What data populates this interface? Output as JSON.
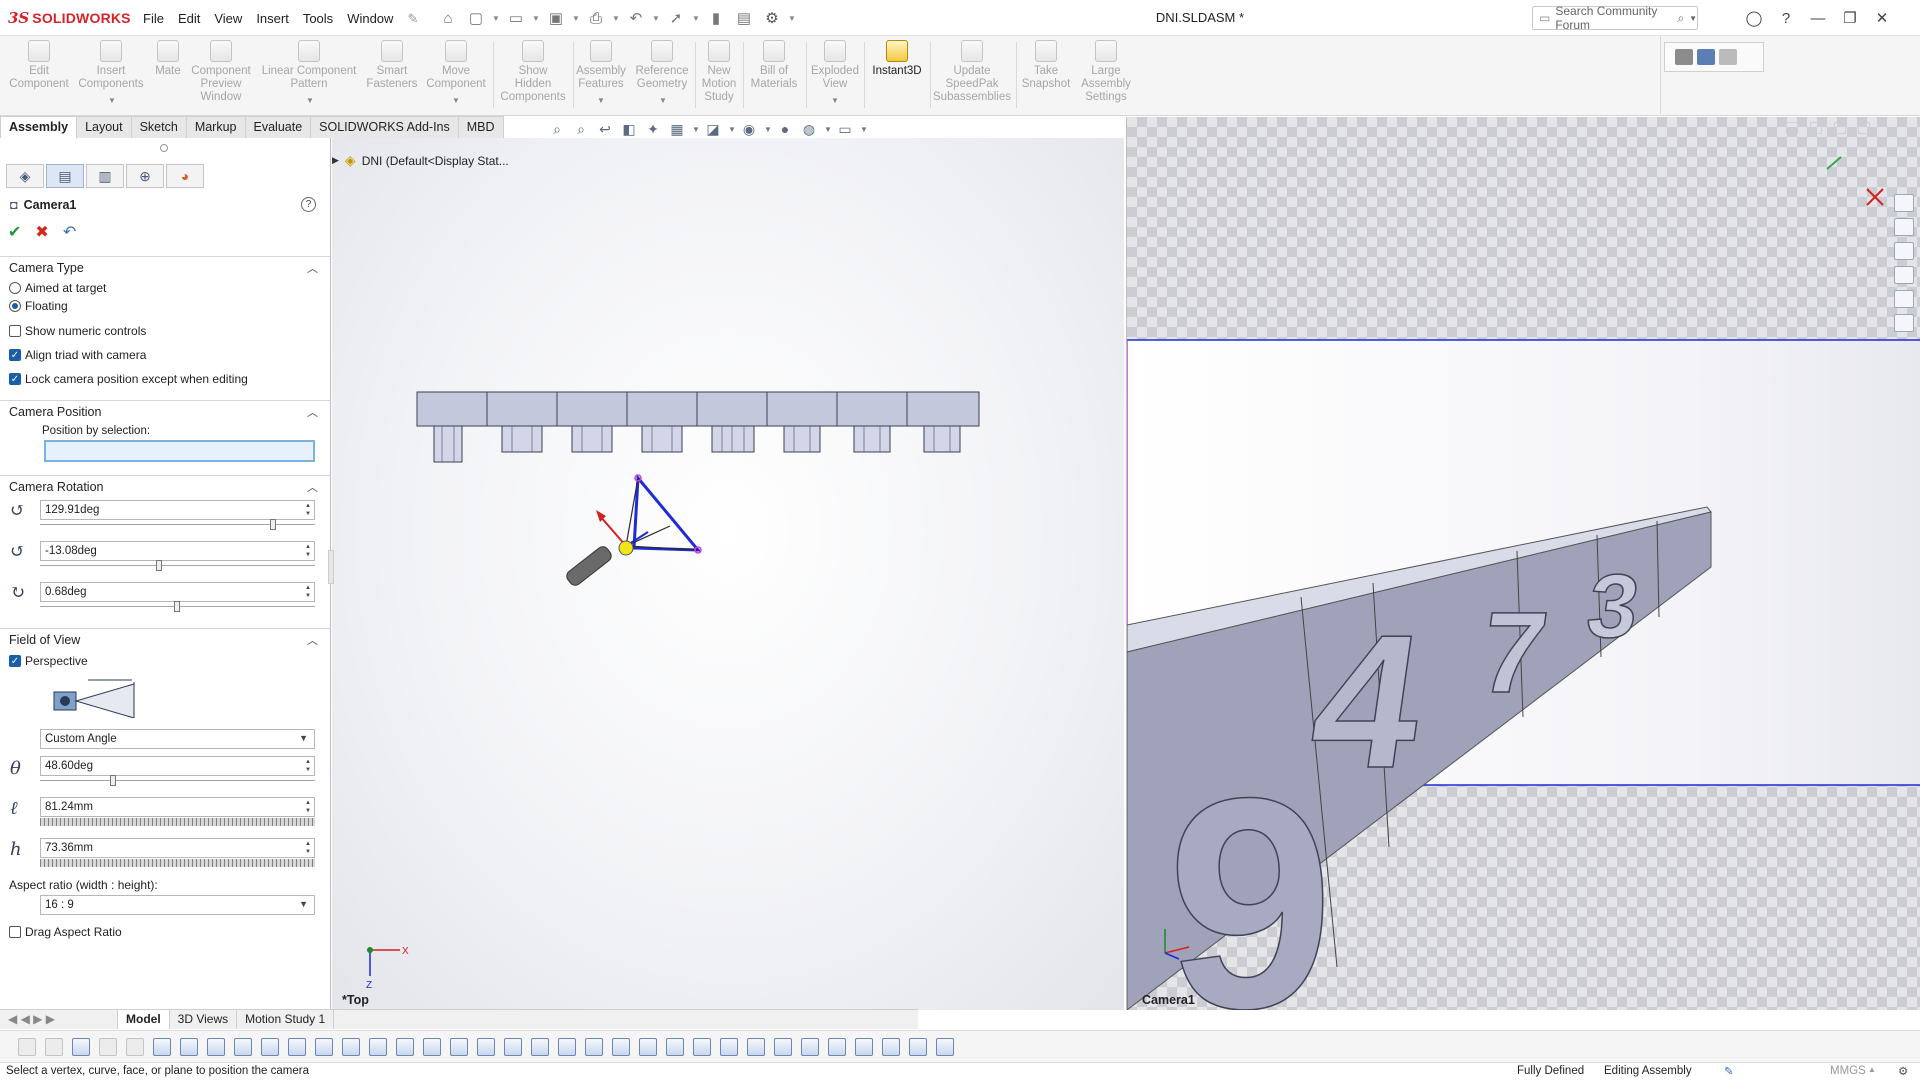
{
  "app": {
    "brand_ds": "3S",
    "brand_name": "SOLIDWORKS",
    "document_title": "DNI.SLDASM *"
  },
  "menu": [
    "File",
    "Edit",
    "View",
    "Insert",
    "Tools",
    "Window"
  ],
  "search": {
    "placeholder": "Search Community Forum"
  },
  "ribbon": [
    {
      "label": "Edit\nComponent"
    },
    {
      "label": "Insert\nComponents"
    },
    {
      "label": "Mate"
    },
    {
      "label": "Component\nPreview\nWindow"
    },
    {
      "label": "Linear Component\nPattern"
    },
    {
      "label": "Smart\nFasteners"
    },
    {
      "label": "Move\nComponent"
    },
    {
      "label": "Show\nHidden\nComponents"
    },
    {
      "label": "Assembly\nFeatures"
    },
    {
      "label": "Reference\nGeometry"
    },
    {
      "label": "New\nMotion\nStudy"
    },
    {
      "label": "Bill of\nMaterials"
    },
    {
      "label": "Exploded\nView"
    },
    {
      "label": "Instant3D"
    },
    {
      "label": "Update\nSpeedPak\nSubassemblies"
    },
    {
      "label": "Take\nSnapshot"
    },
    {
      "label": "Large\nAssembly\nSettings"
    }
  ],
  "tabs": [
    "Assembly",
    "Layout",
    "Sketch",
    "Markup",
    "Evaluate",
    "SOLIDWORKS Add-Ins",
    "MBD"
  ],
  "tree": {
    "root": "DNI  (Default<Display Stat..."
  },
  "pm": {
    "title": "Camera1",
    "camera_type": {
      "header": "Camera Type",
      "aimed": "Aimed at target",
      "floating": "Floating",
      "selected": "floating"
    },
    "show_numeric": {
      "label": "Show numeric controls",
      "checked": false
    },
    "align_triad": {
      "label": "Align triad with camera",
      "checked": true
    },
    "lock_position": {
      "label": "Lock camera position except when editing",
      "checked": true
    },
    "camera_position": {
      "header": "Camera Position",
      "label": "Position by selection:",
      "value": ""
    },
    "camera_rotation": {
      "header": "Camera Rotation",
      "values": [
        "129.91deg",
        "-13.08deg",
        "0.68deg"
      ]
    },
    "field_of_view": {
      "header": "Field of View",
      "perspective": {
        "label": "Perspective",
        "checked": true
      },
      "mode": "Custom Angle",
      "theta": "48.60deg",
      "l": "81.24mm",
      "h": "73.36mm",
      "aspect_label": "Aspect ratio (width : height):",
      "aspect": "16 : 9",
      "drag_aspect": {
        "label": "Drag Aspect Ratio",
        "checked": false
      }
    }
  },
  "bottom_tabs": [
    "Model",
    "3D Views",
    "Motion Study 1"
  ],
  "viewport": {
    "view_label": "*Top",
    "camera_label": "Camera1"
  },
  "preview_digits": [
    "9",
    "4",
    "7",
    "3"
  ],
  "status": {
    "hint": "Select a vertex, curve, face, or plane to position the camera",
    "fully_defined": "Fully Defined",
    "editing": "Editing Assembly",
    "units": "MMGS"
  },
  "colors": {
    "brand": "#d8232a",
    "accent": "#1a5ea8",
    "selection_blue": "#1f2bd6",
    "camera_frame_magenta": "#d43bd8"
  }
}
